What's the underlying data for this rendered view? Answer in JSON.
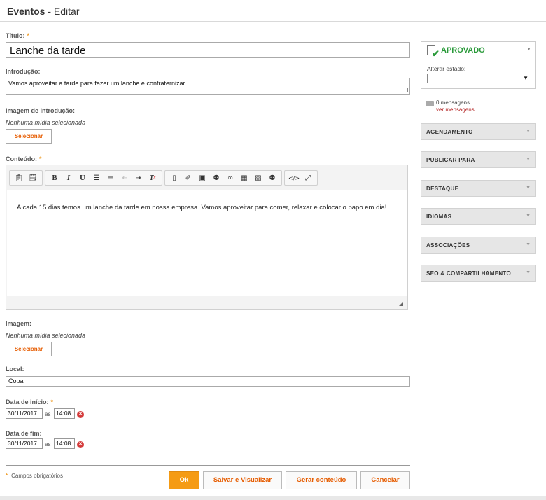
{
  "header": {
    "title_bold": "Eventos",
    "title_rest": " - Editar"
  },
  "form": {
    "titulo_label": "Título:",
    "titulo_value": "Lanche da tarde",
    "introducao_label": "Introdução:",
    "introducao_value": "Vamos aproveitar a tarde para fazer um lanche e confraternizar",
    "imagem_intro_label": "Imagem de introdução:",
    "imagem_intro_empty": "Nenhuma mídia selecionada",
    "select_label": "Selecionar",
    "conteudo_label": "Conteúdo:",
    "conteudo_text": "A cada 15 dias temos um lanche da tarde em nossa empresa. Vamos aproveitar para comer, relaxar e colocar o papo em dia!",
    "imagem_label": "Imagem:",
    "imagem_empty": "Nenhuma mídia selecionada",
    "local_label": "Local:",
    "local_value": "Copa",
    "data_inicio_label": "Data de início:",
    "data_inicio_date": "30/11/2017",
    "data_inicio_time": "14:08",
    "data_fim_label": "Data de fim:",
    "data_fim_date": "30/11/2017",
    "data_fim_time": "14:08",
    "as_label": "as",
    "required_note": "Campos obrigatórios",
    "required_mark": "*"
  },
  "toolbar": {
    "groups": [
      [
        "paste-icon",
        "paste-text-icon"
      ],
      [
        "B",
        "I",
        "U",
        "ordered-list-icon",
        "bullet-list-icon",
        "outdent-icon",
        "indent-icon",
        "clear-format-icon"
      ],
      [
        "document-icon",
        "attachment-icon",
        "image-icon",
        "find-icon",
        "link-icon",
        "embed-icon",
        "preview-icon",
        "find-replace-icon"
      ],
      [
        "source-icon",
        "fullscreen-icon"
      ]
    ]
  },
  "actions": {
    "ok": "Ok",
    "save_view": "Salvar e Visualizar",
    "generate": "Gerar conteúdo",
    "cancel": "Cancelar"
  },
  "sidebar": {
    "status": "APROVADO",
    "status_color": "#2a9a3a",
    "alter_label": "Alterar estado:",
    "messages_count": "0 mensagens",
    "messages_link": "ver mensagens",
    "panels": [
      "AGENDAMENTO",
      "PUBLICAR PARA",
      "DESTAQUE",
      "IDIOMAS",
      "ASSOCIAÇÕES",
      "SEO & COMPARTILHAMENTO"
    ]
  },
  "colors": {
    "accent": "#f59b14",
    "link_orange": "#e65c00",
    "error": "#d43a3a"
  }
}
